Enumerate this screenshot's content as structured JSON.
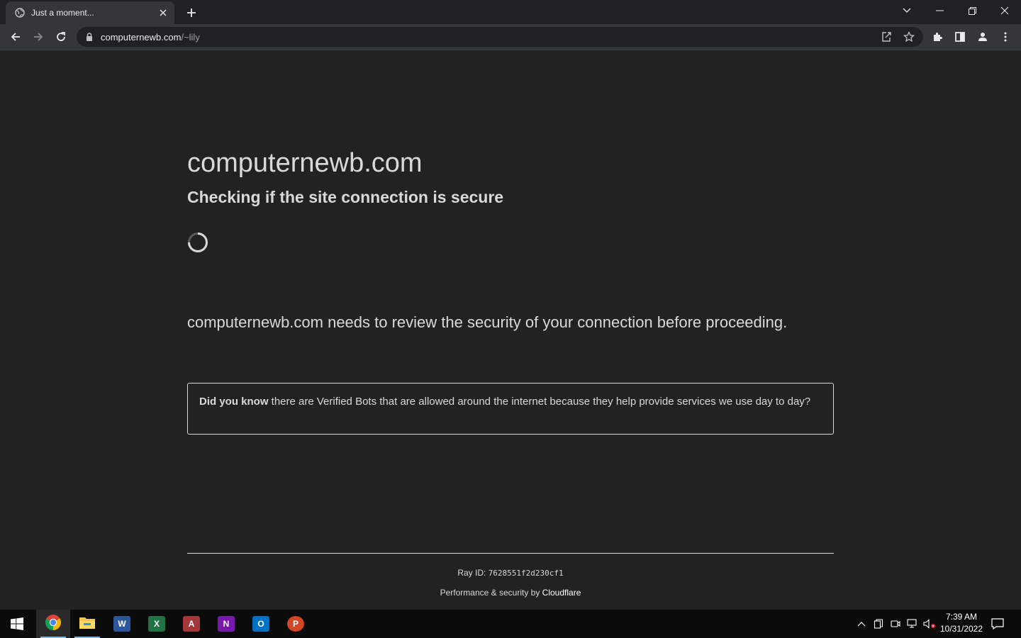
{
  "browser": {
    "tab_title": "Just a moment...",
    "url_host": "computernewb.com",
    "url_path": "/~lily"
  },
  "page": {
    "site_name": "computernewb.com",
    "subtitle": "Checking if the site connection is secure",
    "review_text": "computernewb.com needs to review the security of your connection before proceeding.",
    "did_you_know_bold": "Did you know",
    "did_you_know_text": " there are Verified Bots that are allowed around the internet because they help provide services we use day to day?",
    "ray_label": "Ray ID: ",
    "ray_id": "7628551f2d230cf1",
    "perf_label": "Performance & security by ",
    "perf_link": "Cloudflare"
  },
  "taskbar": {
    "time": "7:39 AM",
    "date": "10/31/2022",
    "apps": [
      "chrome",
      "file-explorer",
      "word",
      "excel",
      "access",
      "onenote",
      "outlook",
      "powerpoint"
    ]
  },
  "colors": {
    "page_bg": "#222222",
    "text": "#d9d9d9",
    "chrome_bg": "#202124",
    "toolbar_bg": "#35363a"
  }
}
